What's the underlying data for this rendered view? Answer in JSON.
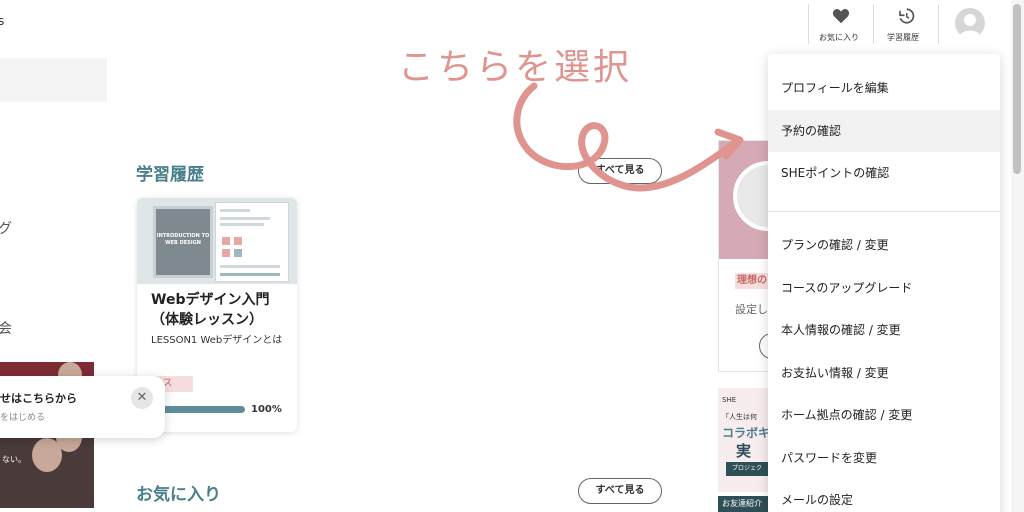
{
  "sidebar": {
    "top_text": "s",
    "items": [
      {
        "label": "グ"
      },
      {
        "label": "会"
      }
    ]
  },
  "history_section": {
    "title": "学習履歴",
    "see_all_label": "すべて見る",
    "course": {
      "thumbnail_text": "INTRODUCTION TO WEB DESIGN",
      "title": "Webデザイン入門（体験レッスン）",
      "lesson": "LESSON1 Webデザインとは",
      "tag": "コース",
      "progress": 100,
      "progress_text": "100%"
    }
  },
  "favorites_section": {
    "title": "お気に入り",
    "see_all_label": "すべて見る"
  },
  "notification": {
    "title": "せはこちらから",
    "subtitle": "をはじめる",
    "close": "✕"
  },
  "side_photo": {
    "caption": "ない。"
  },
  "right_content": {
    "tag": "理想の",
    "setting_text": "設定し",
    "banner_line1": "SHE",
    "banner_line2": "「人生は何",
    "banner_line3": "コラボキ",
    "banner_line4": "実",
    "banner_button": "プロジェク",
    "refer": "お友達紹介"
  },
  "header": {
    "favorites_label": "お気に入り",
    "history_label": "学習履歴"
  },
  "dropdown": {
    "items": [
      {
        "label": "プロフィールを編集",
        "active": false
      },
      {
        "label": "予約の確認",
        "active": true
      },
      {
        "label": "SHEポイントの確認",
        "active": false
      },
      {
        "label": "プランの確認 / 変更",
        "active": false
      },
      {
        "label": "コースのアップグレード",
        "active": false
      },
      {
        "label": "本人情報の確認 / 変更",
        "active": false
      },
      {
        "label": "お支払い情報 / 変更",
        "active": false
      },
      {
        "label": "ホーム拠点の確認 / 変更",
        "active": false
      },
      {
        "label": "パスワードを変更",
        "active": false
      },
      {
        "label": "メールの設定",
        "active": false
      }
    ]
  },
  "annotation": {
    "text": "こちらを選択",
    "color": "#e0948f"
  },
  "colors": {
    "accent": "#4a7f8c",
    "tag_bg": "#f6dede",
    "tag_text": "#c86a6a"
  }
}
